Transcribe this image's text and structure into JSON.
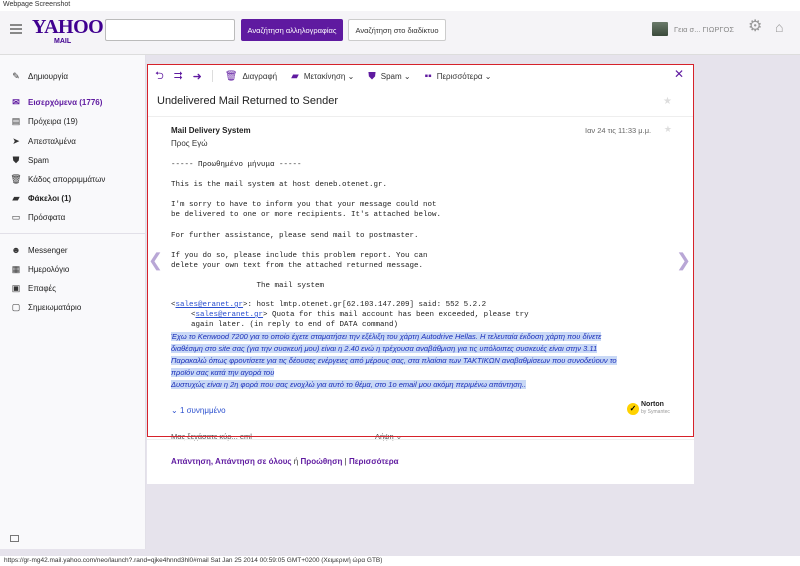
{
  "screenshot_title": "Webpage Screenshot",
  "header": {
    "logo": "YAHOO!",
    "logo_sub": "MAIL",
    "search_placeholder": "",
    "search_mail_button": "Αναζήτηση αλληλογραφίας",
    "search_web_button": "Αναζήτηση στο διαδίκτυο",
    "user_greeting": "Γεια σ...  ΓΙΩΡΓΟΣ"
  },
  "sidebar": {
    "compose": "Δημιουργία",
    "inbox": "Εισερχόμενα (1776)",
    "drafts": "Πρόχειρα (19)",
    "sent": "Απεσταλμένα",
    "spam": "Spam",
    "trash": "Κάδος απορριμμάτων",
    "folders": "Φάκελοι (1)",
    "recent": "Πρόσφατα",
    "messenger": "Messenger",
    "calendar": "Ημερολόγιο",
    "contacts": "Επαφές",
    "notepad": "Σημειωματάριο"
  },
  "toolbar": {
    "delete": "Διαγραφή",
    "move": "Μετακίνηση",
    "spam": "Spam",
    "more": "Περισσότερα"
  },
  "message": {
    "subject": "Undelivered Mail Returned to Sender",
    "sender": "Mail Delivery System",
    "to": "Προς Εγώ",
    "date": "Ιαν 24 τις 11:33 μ.μ.",
    "body_lines": [
      "----- Προωθημένο μήνυμα -----",
      "This is the mail system at host deneb.otenet.gr.",
      "I'm sorry to have to inform you that your message could not",
      "be delivered to one or more recipients. It's attached below.",
      "For further assistance, please send mail to postmaster.",
      "If you do so, please include this problem report. You can",
      "delete your own text from the attached returned message.",
      "                   The mail system"
    ],
    "email1": "sales@eranet.gr",
    "line_host": ">: host lmtp.otenet.gr[62.103.147.209] said: 552 5.2.2",
    "email2": "sales@eranet.gr",
    "line_quota": "> Quota for this mail account has been exceeded, please try",
    "line_later": "again later. (in reply to end of DATA command)",
    "highlighted": [
      "Έχω το Kenwood 7200 για το οποίο έχετε σταματήσει την εξέλιξη του χάρτη Autodrive Hellas. Η τελευταία έκδοση χάρτη που δίνετε",
      "διαθέσιμη στο site σας (για την συσκευή μου) είναι η 2.40 ενώ η τρέχουσα αναβάθμιση για τις υπόλοιπες συσκευές είναι στην 3.11",
      "Παρακαλώ όπως φροντίσετε για τις δέουσες ενέργειες από μέρους σας, στα πλαίσια των ΤΑΚΤΙΚΩΝ αναβαθμίσεων που συνοδεύουν το",
      "προϊόν σας κατά την αγορά του",
      "Δυστυχώς είναι η 2η φορά που σας ενοχλώ για αυτό το θέμα, στο 1ο email μου ακόμη περιμένω απάντηση.."
    ],
    "thread_link": "1 συνημμένο",
    "norton": "Norton",
    "norton_sub": "by Symantec",
    "reply_peek_left": "Μας ξεχάσατε κύρ... eml",
    "reply_peek_right": "Λήψη"
  },
  "actions": {
    "reply": "Απάντηση",
    "reply_all": "Απάντηση σε όλους",
    "or": "ή",
    "forward": "Προώθηση",
    "more": "Περισσότερα"
  },
  "status": "https://gr-mg42.mail.yahoo.com/neo/launch?.rand=qjke4hnnd3hl0#mail Sat Jan 25 2014 00:59:05 GMT+0200 (Χειμερινή ώρα GTB)",
  "colors": {
    "brand": "#5f1aa0",
    "frame": "#d6222a",
    "highlight": "#c8d8f6"
  }
}
